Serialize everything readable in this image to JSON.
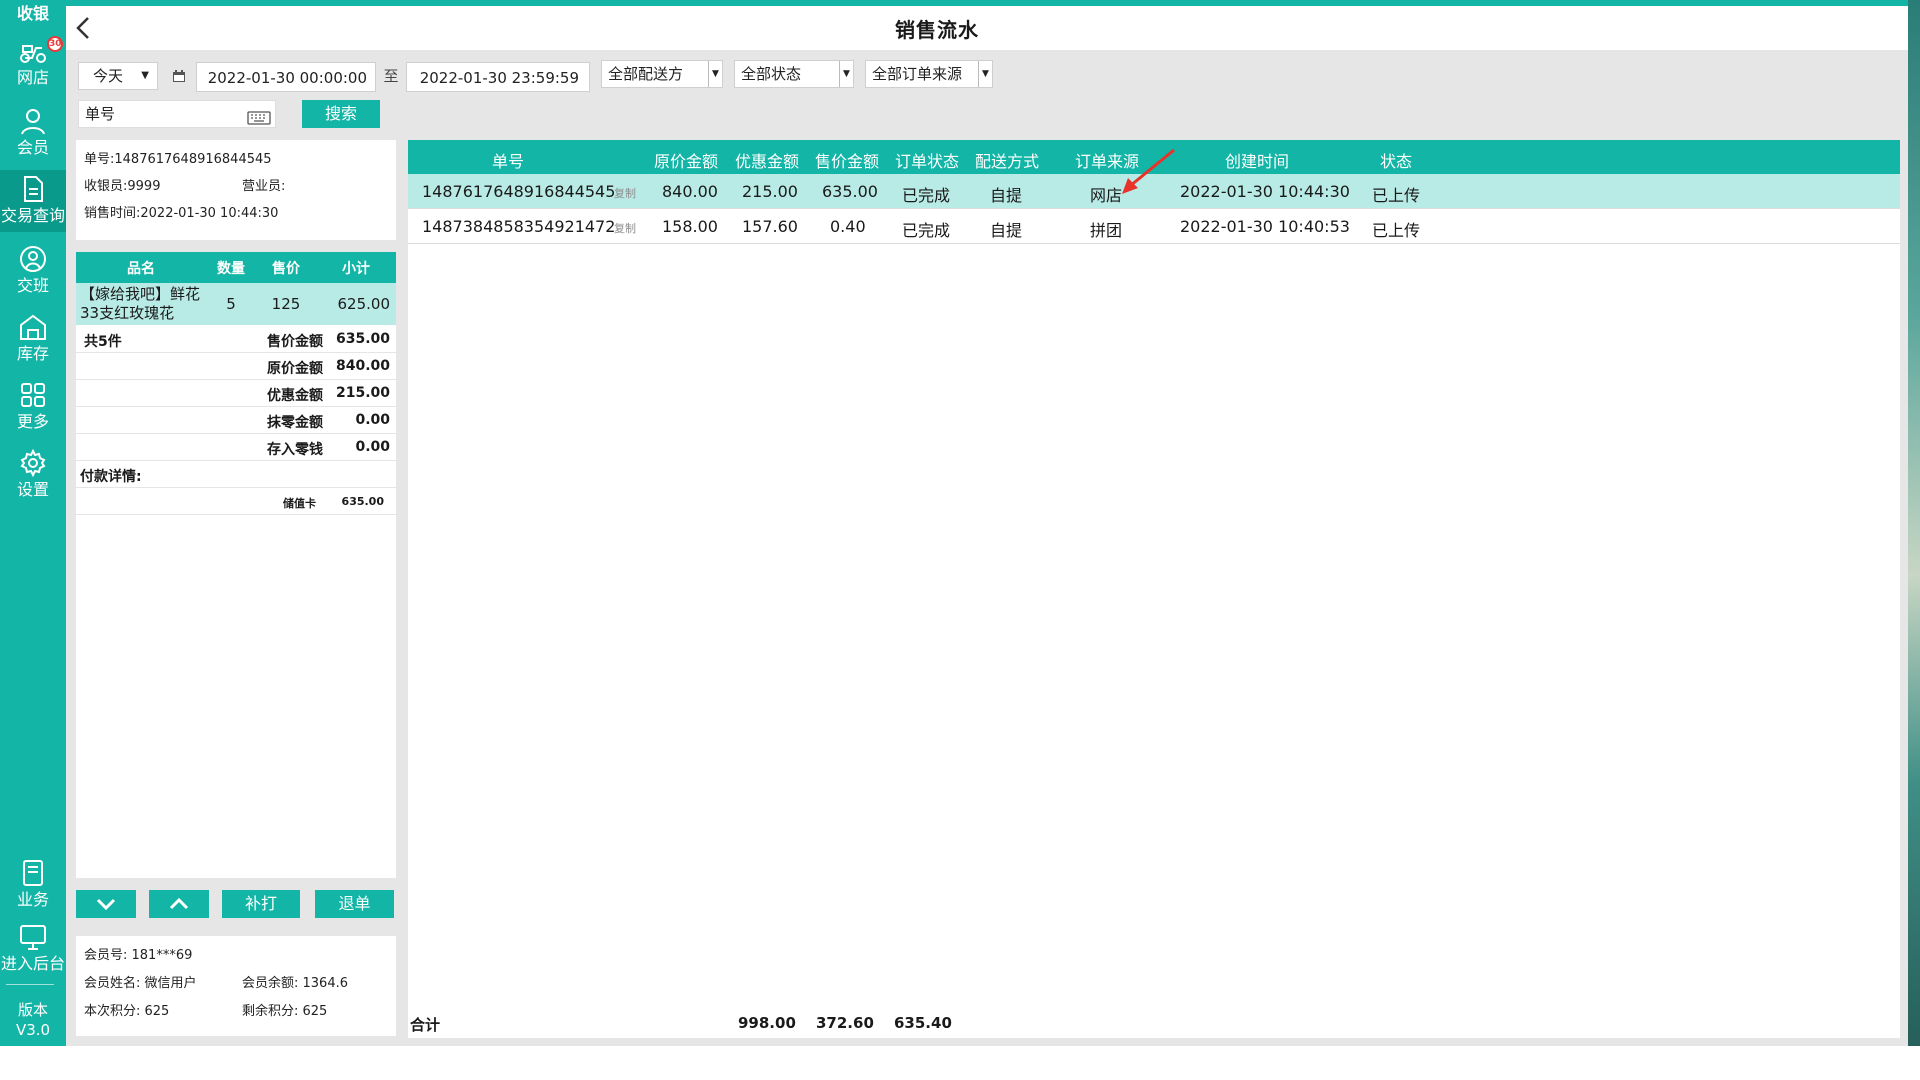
{
  "sidebar": {
    "items": [
      {
        "label": "收银"
      },
      {
        "label": "网店",
        "badge": "30"
      },
      {
        "label": "会员"
      },
      {
        "label": "交易查询"
      },
      {
        "label": "交班"
      },
      {
        "label": "库存"
      },
      {
        "label": "更多"
      },
      {
        "label": "设置"
      }
    ],
    "bottom": [
      {
        "label": "业务"
      },
      {
        "label": "进入后台"
      }
    ],
    "version_label": "版本",
    "version": "V3.0"
  },
  "header": {
    "title": "销售流水"
  },
  "filters": {
    "period": "今天",
    "start_time": "2022-01-30 00:00:00",
    "range_sep": "至",
    "end_time": "2022-01-30 23:59:59",
    "delivery": "全部配送方",
    "status": "全部状态",
    "source": "全部订单来源",
    "order_no_label": "单号",
    "search_label": "搜索"
  },
  "order_detail": {
    "order_no": "单号:1487617648916844545",
    "cashier": "收银员:9999",
    "salesperson": "营业员:",
    "sale_time": "销售时间:2022-01-30 10:44:30",
    "item_columns": [
      "品名",
      "数量",
      "售价",
      "小计"
    ],
    "items": [
      {
        "name": "【嫁给我吧】鲜花33支红玫瑰花",
        "qty": "5",
        "price": "125",
        "subtotal": "625.00"
      }
    ],
    "total_count": "共5件",
    "summary": [
      {
        "label": "售价金额",
        "value": "635.00"
      },
      {
        "label": "原价金额",
        "value": "840.00"
      },
      {
        "label": "优惠金额",
        "value": "215.00"
      },
      {
        "label": "抹零金额",
        "value": "0.00"
      },
      {
        "label": "存入零钱",
        "value": "0.00"
      }
    ],
    "payment_title": "付款详情:",
    "payment": {
      "method": "储值卡",
      "amount": "635.00"
    }
  },
  "actions": {
    "reprint": "补打",
    "refund": "退单"
  },
  "member": {
    "member_no": "会员号: 181***69",
    "member_name": "会员姓名: 微信用户",
    "balance": "会员余额: 1364.6",
    "points_this": "本次积分: 625",
    "points_left": "剩余积分: 625"
  },
  "orders_table": {
    "columns": [
      "单号",
      "原价金额",
      "优惠金额",
      "售价金额",
      "订单状态",
      "配送方式",
      "订单来源",
      "创建时间",
      "状态"
    ],
    "copy_label": "复制",
    "rows": [
      {
        "order_no": "1487617648916844545",
        "original": "840.00",
        "discount": "215.00",
        "sale": "635.00",
        "order_status": "已完成",
        "delivery": "自提",
        "source": "网店",
        "created": "2022-01-30 10:44:30",
        "status": "已上传"
      },
      {
        "order_no": "1487384858354921472",
        "original": "158.00",
        "discount": "157.60",
        "sale": "0.40",
        "order_status": "已完成",
        "delivery": "自提",
        "source": "拼团",
        "created": "2022-01-30 10:40:53",
        "status": "已上传"
      }
    ],
    "total_label": "合计",
    "totals": {
      "original": "998.00",
      "discount": "372.60",
      "sale": "635.40"
    }
  },
  "colors": {
    "accent": "#12b5a6",
    "selected_row": "#b9ebe6",
    "arrow": "#e8332a"
  }
}
